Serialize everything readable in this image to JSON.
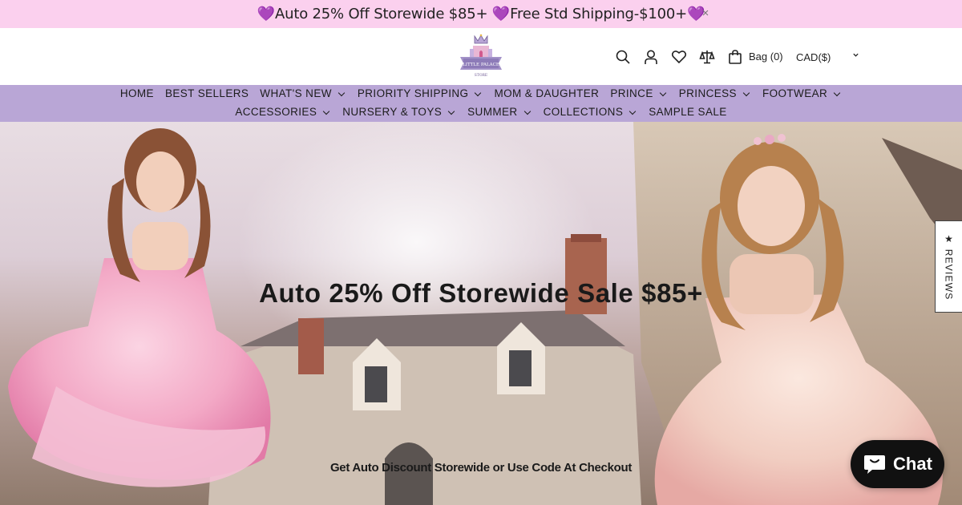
{
  "announcement": {
    "text": "💜Auto 25% Off Storewide $85+ 💜Free Std Shipping-$100+💜",
    "close": "×"
  },
  "header": {
    "bag_label": "Bag (0)",
    "currency": "CAD($)",
    "icons": [
      "search-icon",
      "account-icon",
      "wishlist-icon",
      "compare-icon",
      "bag-icon"
    ]
  },
  "nav": {
    "row1": [
      {
        "label": "HOME",
        "dropdown": false
      },
      {
        "label": "BEST SELLERS",
        "dropdown": false
      },
      {
        "label": "WHAT'S NEW",
        "dropdown": true
      },
      {
        "label": "PRIORITY SHIPPING",
        "dropdown": true
      },
      {
        "label": "MOM & DAUGHTER",
        "dropdown": false
      },
      {
        "label": "PRINCE",
        "dropdown": true
      },
      {
        "label": "PRINCESS",
        "dropdown": true
      },
      {
        "label": "FOOTWEAR",
        "dropdown": true
      }
    ],
    "row2": [
      {
        "label": "ACCESSORIES",
        "dropdown": true
      },
      {
        "label": "NURSERY & TOYS",
        "dropdown": true
      },
      {
        "label": "SUMMER",
        "dropdown": true
      },
      {
        "label": "COLLECTIONS",
        "dropdown": true
      },
      {
        "label": "SAMPLE SALE",
        "dropdown": false
      }
    ]
  },
  "hero": {
    "title": "Auto 25% Off Storewide Sale $85+",
    "subtitle": "Get Auto Discount Storewide or Use Code At Checkout"
  },
  "reviews_tab": "★ REVIEWS",
  "chat": {
    "label": "Chat"
  },
  "colors": {
    "announcement_bg": "#fbd0ee",
    "nav_bg": "#b9a6d6",
    "chat_bg": "#111111"
  }
}
